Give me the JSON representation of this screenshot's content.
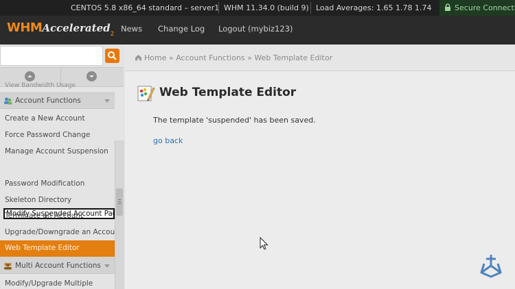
{
  "statusbar": {
    "os": "CENTOS 5.8 x86_64 standard – server1",
    "whm_version": "WHM 11.34.0 (build 9)",
    "load_averages": "Load Averages: 1.65 1.78 1.74",
    "secure": "Secure Connectio"
  },
  "header": {
    "logo_whm": "WHM",
    "logo_accelerated": "Accelerated",
    "logo_sub": "2",
    "nav": {
      "news": "News",
      "changelog": "Change Log",
      "logout": "Logout (mybiz123)"
    }
  },
  "sidebar": {
    "search_placeholder": "",
    "partial_top_item": "View Bandwidth Usage",
    "section_account": "Account Functions",
    "items": [
      "Create a New Account",
      "Force Password Change",
      "Manage Account Suspension",
      "Modify Suspended Account Page",
      "Password Modification",
      "Skeleton Directory",
      "Terminate an Account",
      "Upgrade/Downgrade an Account",
      "Web Template Editor"
    ],
    "section_multi": "Multi Account Functions",
    "multi_items": [
      "Modify/Upgrade Multiple"
    ]
  },
  "breadcrumb": {
    "home": "Home",
    "sep1": "»",
    "section": "Account Functions",
    "sep2": "»",
    "current": "Web Template Editor"
  },
  "main": {
    "title": "Web Template Editor",
    "message": "The template 'suspended' has been saved.",
    "go_back": "go back"
  },
  "colors": {
    "accent": "#e37e10",
    "link": "#2c6eb3",
    "topbar": "#202020"
  }
}
